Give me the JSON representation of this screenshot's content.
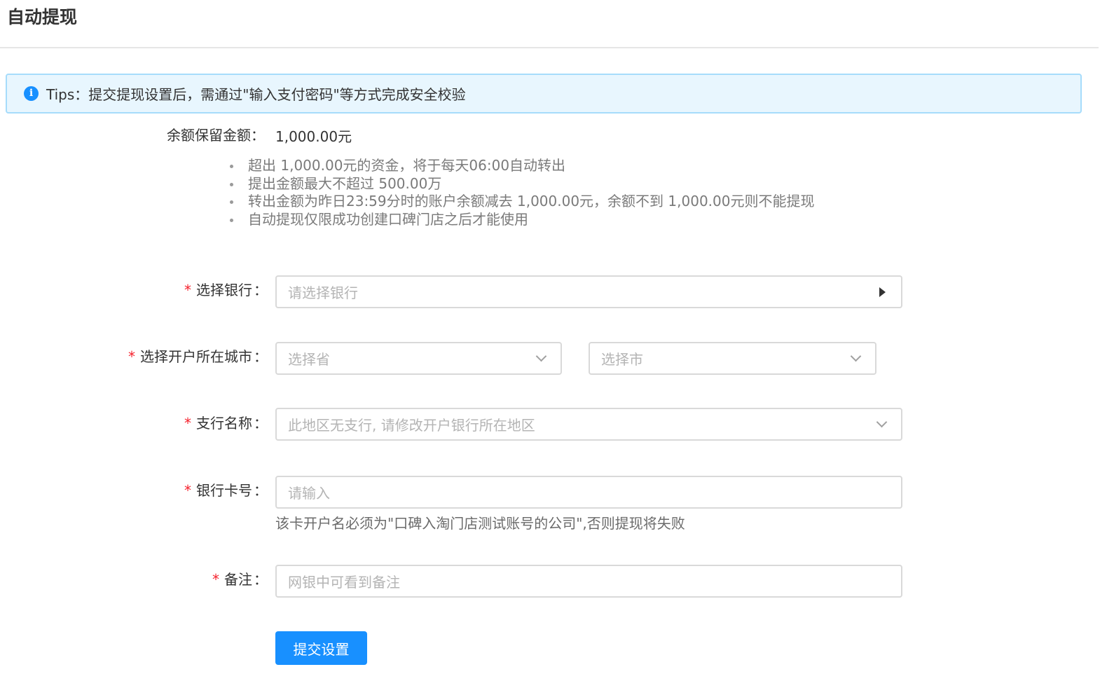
{
  "header": {
    "title": "自动提现"
  },
  "tips": {
    "icon": "info-icon",
    "text": "Tips：提交提现设置后，需通过\"输入支付密码\"等方式完成安全校验"
  },
  "balance": {
    "label": "余额保留金额：",
    "value": "1,000.00元"
  },
  "notes": [
    "超出 1,000.00元的资金，将于每天06:00自动转出",
    "提出金额最大不超过 500.00万",
    "转出金额为昨日23:59分时的账户余额减去 1,000.00元，余额不到 1,000.00元则不能提现",
    "自动提现仅限成功创建口碑门店之后才能使用"
  ],
  "form": {
    "required_mark": "*",
    "colon": "：",
    "bank": {
      "label": "选择银行",
      "placeholder": "请选择银行"
    },
    "city": {
      "label": "选择开户所在城市",
      "province_placeholder": "选择省",
      "city_placeholder": "选择市"
    },
    "branch": {
      "label": "支行名称",
      "placeholder": "此地区无支行, 请修改开户银行所在地区"
    },
    "card": {
      "label": "银行卡号",
      "placeholder": "请输入",
      "help": "该卡开户名必须为\"口碑入淘门店测试账号的公司\",否则提现将失败"
    },
    "remark": {
      "label": "备注",
      "placeholder": "网银中可看到备注"
    },
    "submit_label": "提交设置"
  },
  "colors": {
    "primary": "#1890ff",
    "required": "#f5222d",
    "tips_bg": "#e8f6fe",
    "tips_border": "#a6dcfb"
  }
}
